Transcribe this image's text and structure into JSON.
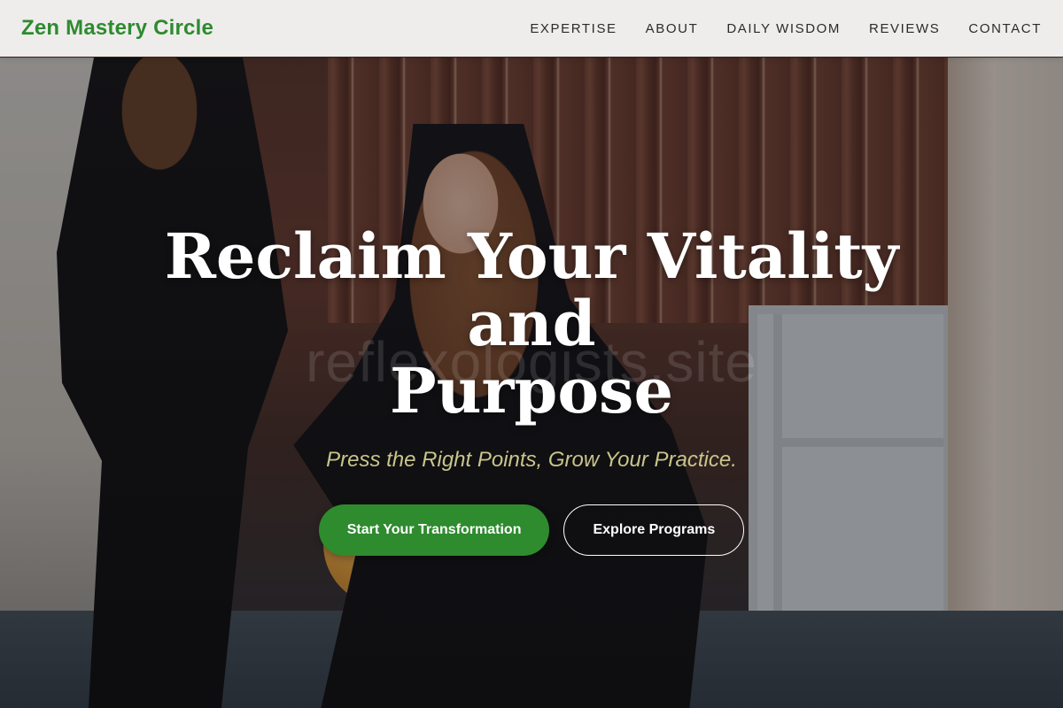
{
  "brand": {
    "logo_text": "Zen Mastery Circle",
    "accent_color": "#2e8b2e"
  },
  "nav": {
    "items": [
      {
        "label": "EXPERTISE"
      },
      {
        "label": "ABOUT"
      },
      {
        "label": "DAILY WISDOM"
      },
      {
        "label": "REVIEWS"
      },
      {
        "label": "CONTACT"
      }
    ]
  },
  "hero": {
    "title_line1": "Reclaim Your Vitality and",
    "title_line2": "Purpose",
    "watermark": "reflexologists.site",
    "subtitle": "Press the Right Points, Grow Your Practice.",
    "primary_cta": "Start Your Transformation",
    "secondary_cta": "Explore Programs"
  }
}
